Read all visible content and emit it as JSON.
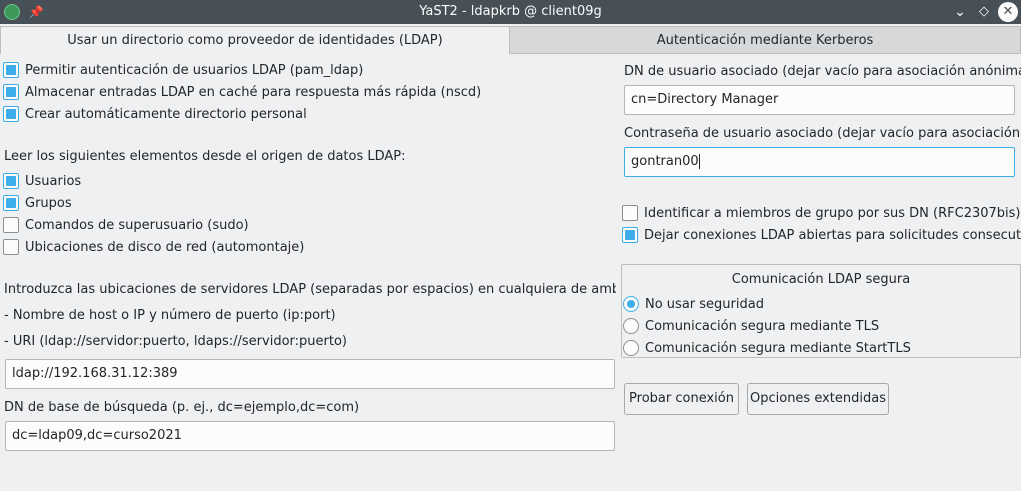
{
  "window": {
    "title": "YaST2 - ldapkrb @ client09g",
    "app_icon": "yast-icon",
    "pin_icon": "pin-icon",
    "controls": {
      "minimize": "⌄",
      "maximize": "◇",
      "close": "✕"
    }
  },
  "tabs": [
    {
      "label": "Usar un directorio como proveedor de identidades (LDAP)",
      "active": true
    },
    {
      "label": "Autenticación mediante Kerberos",
      "active": false
    }
  ],
  "left": {
    "options": [
      {
        "label": "Permitir autenticación de usuarios LDAP (pam_ldap)",
        "checked": true
      },
      {
        "label": "Almacenar entradas LDAP en caché para respuesta más rápida (nscd)",
        "checked": true
      },
      {
        "label": "Crear automáticamente directorio personal",
        "checked": true
      }
    ],
    "read_heading": "Leer los siguientes elementos desde el origen de datos LDAP:",
    "read_items": [
      {
        "label": "Usuarios",
        "checked": true
      },
      {
        "label": "Grupos",
        "checked": true
      },
      {
        "label": "Comandos de superusuario (sudo)",
        "checked": false
      },
      {
        "label": "Ubicaciones de disco de red (automontaje)",
        "checked": false
      }
    ],
    "servers_intro": "Introduzca las ubicaciones de servidores LDAP (separadas por espacios) en cualquiera de ambos forr",
    "servers_hint1": "- Nombre de host o IP y número de puerto (ip:port)",
    "servers_hint2": "- URI (ldap://servidor:puerto, ldaps://servidor:puerto)",
    "servers_value": "ldap://192.168.31.12:389",
    "base_dn_label": "DN de base de búsqueda (p. ej., dc=ejemplo,dc=com)",
    "base_dn_value": "dc=ldap09,dc=curso2021"
  },
  "right": {
    "bind_dn_label": "DN de usuario asociado (dejar vacío para asociación anónima)",
    "bind_dn_value": "cn=Directory Manager",
    "bind_pw_label": "Contraseña de usuario asociado (dejar vacío para asociación anó",
    "bind_pw_value": "gontran00",
    "rfc2307bis": {
      "label": "Identificar a miembros de grupo por sus DN (RFC2307bis)",
      "checked": false
    },
    "persistent": {
      "label": "Dejar conexiones LDAP abiertas para solicitudes consecutivas",
      "checked": true
    },
    "secure_title": "Comunicación LDAP segura",
    "secure_options": [
      {
        "label": "No usar seguridad",
        "selected": true
      },
      {
        "label": "Comunicación segura mediante TLS",
        "selected": false
      },
      {
        "label": "Comunicación segura mediante StartTLS",
        "selected": false
      }
    ],
    "test_button": "Probar conexión",
    "extended_button": "Opciones extendidas"
  }
}
